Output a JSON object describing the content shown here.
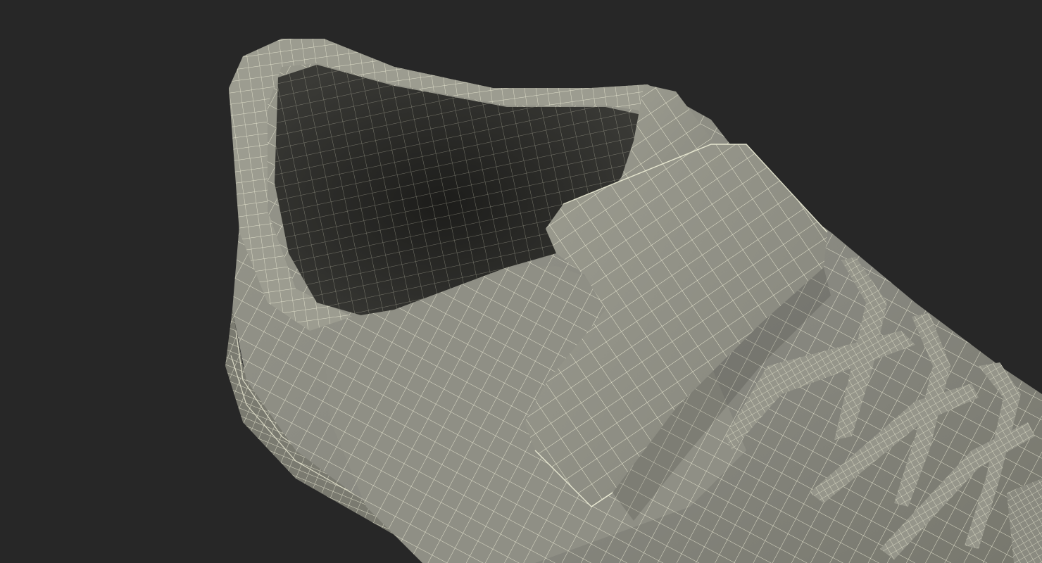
{
  "scene": {
    "subject": "wireframe-sneaker",
    "colors": {
      "background": "#272727",
      "surface": "#8b8b7e",
      "surface_light": "#a1a195",
      "surface_dark": "#6c6c62",
      "interior": "#2f2f2c",
      "interior_deep": "#1d1d1b",
      "wire": "#f0efd8"
    }
  }
}
